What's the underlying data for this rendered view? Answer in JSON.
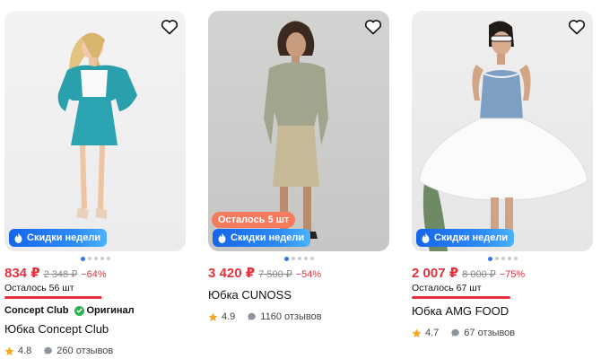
{
  "promo_label": "Скидки недели",
  "products": [
    {
      "price": "834 ₽",
      "old_price": "2 348 ₽",
      "discount": "−64%",
      "remaining": "Осталось 56 шт",
      "remaining_progress": 0.98,
      "brand": "Concept Club",
      "original_label": "Оригинал",
      "title": "Юбка Concept Club",
      "rating": "4.8",
      "reviews": "260 отзывов"
    },
    {
      "stock_badge": "Осталось 5 шт",
      "price": "3 420 ₽",
      "old_price": "7 500 ₽",
      "discount": "−54%",
      "title": "Юбка CUNOSS",
      "rating": "4.9",
      "reviews": "1160 отзывов"
    },
    {
      "price": "2 007 ₽",
      "old_price": "8 000 ₽",
      "discount": "−75%",
      "remaining": "Осталось 67 шт",
      "remaining_progress": 1.0,
      "title": "Юбка AMG FOOD",
      "rating": "4.7",
      "reviews": "67 отзывов"
    }
  ],
  "colors": {
    "price": "#e5313e",
    "promo": "#1f6fee",
    "star": "#f5a623",
    "original_check": "#2eb14f"
  },
  "icons": [
    "heart-icon",
    "fire-icon",
    "star-icon",
    "chat-bubble-icon",
    "check-icon"
  ]
}
